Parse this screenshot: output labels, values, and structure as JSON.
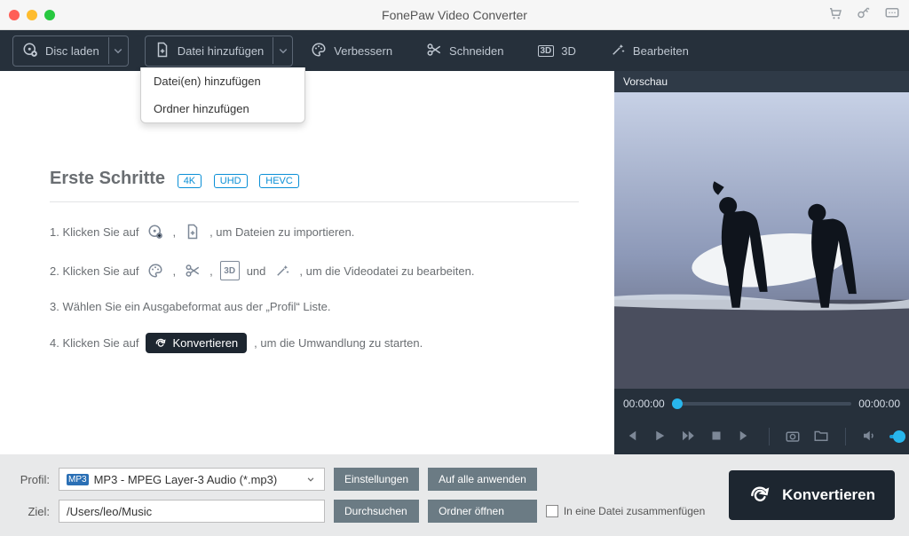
{
  "titlebar": {
    "title": "FonePaw Video Converter"
  },
  "menubar": {
    "disc": "Disc laden",
    "addFile": "Datei hinzufügen",
    "enhance": "Verbessern",
    "cut": "Schneiden",
    "threeD": "3D",
    "edit": "Bearbeiten"
  },
  "dropdown": {
    "addFiles": "Datei(en) hinzufügen",
    "addFolder": "Ordner hinzufügen"
  },
  "gettingStarted": {
    "heading": "Erste Schritte",
    "badge4k": "4K",
    "badgeUhd": "UHD",
    "badgeHevc": "HEVC",
    "step1_a": "1. Klicken Sie auf",
    "step1_b": ", um Dateien zu importieren.",
    "step2_a": "2. Klicken Sie auf",
    "step2_und": "und",
    "step2_b": ", um die Videodatei zu bearbeiten.",
    "step3": "3. Wählen Sie ein Ausgabeformat aus der „Profil“ Liste.",
    "step4_a": "4. Klicken Sie auf",
    "step4_pill": "Konvertieren",
    "step4_b": ", um die Umwandlung zu starten."
  },
  "preview": {
    "header": "Vorschau",
    "timeStart": "00:00:00",
    "timeEnd": "00:00:00"
  },
  "footer": {
    "profileLabel": "Profil:",
    "profileValue": "MP3 - MPEG Layer-3 Audio (*.mp3)",
    "destLabel": "Ziel:",
    "destValue": "/Users/leo/Music",
    "settings": "Einstellungen",
    "applyAll": "Auf alle anwenden",
    "browse": "Durchsuchen",
    "openFolder": "Ordner öffnen",
    "merge": "In eine Datei zusammenfügen",
    "convert": "Konvertieren"
  }
}
